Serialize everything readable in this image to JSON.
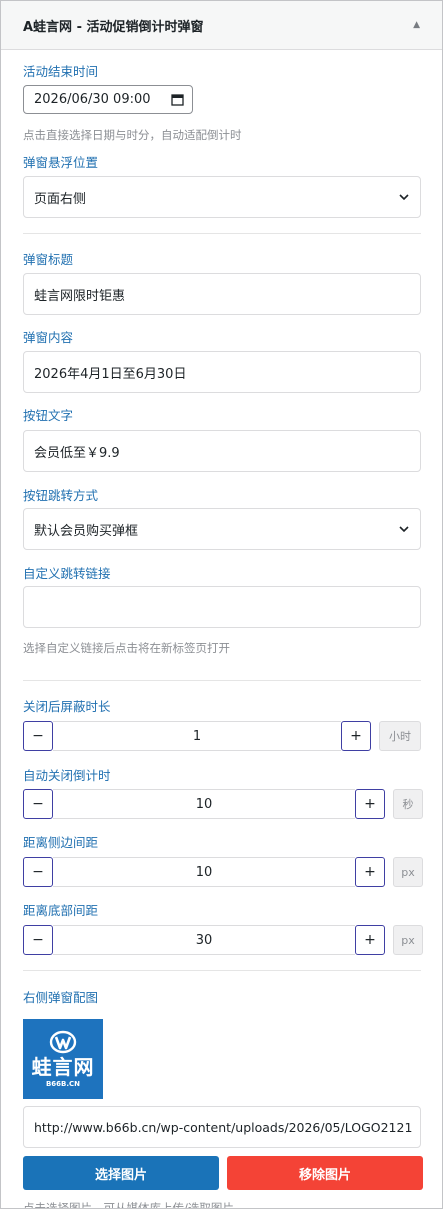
{
  "panel": {
    "title": "A蛙言网 - 活动促销倒计时弹窗",
    "toggle_glyph": "▲"
  },
  "end_time": {
    "label": "活动结束时间",
    "value": "2026/06/30 09:00",
    "hint": "点击直接选择日期与时分，自动适配倒计时"
  },
  "position": {
    "label": "弹窗悬浮位置",
    "value": "页面右侧"
  },
  "popup_title": {
    "label": "弹窗标题",
    "value": "蛙言网限时钜惠"
  },
  "popup_content": {
    "label": "弹窗内容",
    "value": "2026年4月1日至6月30日"
  },
  "button_text": {
    "label": "按钮文字",
    "value": "会员低至￥9.9"
  },
  "button_action": {
    "label": "按钮跳转方式",
    "value": "默认会员购买弹框"
  },
  "custom_link": {
    "label": "自定义跳转链接",
    "value": "",
    "hint": "选择自定义链接后点击将在新标签页打开"
  },
  "steppers": [
    {
      "label": "关闭后屏蔽时长",
      "value": "1",
      "unit": "小时",
      "minus": "−",
      "plus": "+"
    },
    {
      "label": "自动关闭倒计时",
      "value": "10",
      "unit": "秒",
      "minus": "−",
      "plus": "+"
    },
    {
      "label": "距离侧边间距",
      "value": "10",
      "unit": "px",
      "minus": "−",
      "plus": "+"
    },
    {
      "label": "距离底部间距",
      "value": "30",
      "unit": "px",
      "minus": "−",
      "plus": "+"
    }
  ],
  "image": {
    "label": "右侧弹窗配图",
    "logo_text": "蛙言网",
    "logo_sub": "B66B.CN",
    "url": "http://www.b66b.cn/wp-content/uploads/2026/05/LOGO2121",
    "select_label": "选择图片",
    "remove_label": "移除图片",
    "hint": "点击选择图片，可从媒体库上传/选取图片"
  },
  "colors": {
    "primary": "#1a73b8",
    "danger": "#f44336",
    "label": "#2271b1"
  }
}
